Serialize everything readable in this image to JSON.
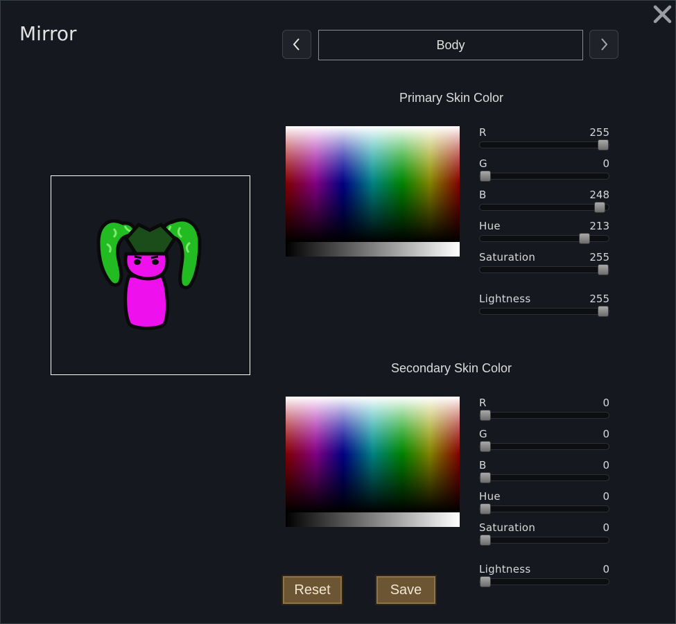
{
  "window": {
    "title": "Mirror"
  },
  "icons": {
    "close": "close-x-icon",
    "prev": "chevron-left-icon",
    "next": "chevron-right-icon"
  },
  "selector": {
    "value": "Body"
  },
  "primary": {
    "title": "Primary Skin Color",
    "sliders": [
      {
        "label": "R",
        "value": "255",
        "fraction": 0.955
      },
      {
        "label": "G",
        "value": "0",
        "fraction": 0.045
      },
      {
        "label": "B",
        "value": "248",
        "fraction": 0.93
      },
      {
        "label": "Hue",
        "value": "213",
        "fraction": 0.81
      },
      {
        "label": "Saturation",
        "value": "255",
        "fraction": 0.955
      },
      {
        "label": "Lightness",
        "value": "255",
        "fraction": 0.955
      }
    ]
  },
  "secondary": {
    "title": "Secondary Skin Color",
    "sliders": [
      {
        "label": "R",
        "value": "0",
        "fraction": 0.045
      },
      {
        "label": "G",
        "value": "0",
        "fraction": 0.045
      },
      {
        "label": "B",
        "value": "0",
        "fraction": 0.045
      },
      {
        "label": "Hue",
        "value": "0",
        "fraction": 0.045
      },
      {
        "label": "Saturation",
        "value": "0",
        "fraction": 0.045
      },
      {
        "label": "Lightness",
        "value": "0",
        "fraction": 0.045
      }
    ]
  },
  "buttons": {
    "reset": "Reset",
    "save": "Save"
  },
  "colors": {
    "creature_body": "#ee11ee",
    "creature_horns": "#22bb22",
    "button_fill": "#6b5533",
    "background": "#15191f"
  }
}
